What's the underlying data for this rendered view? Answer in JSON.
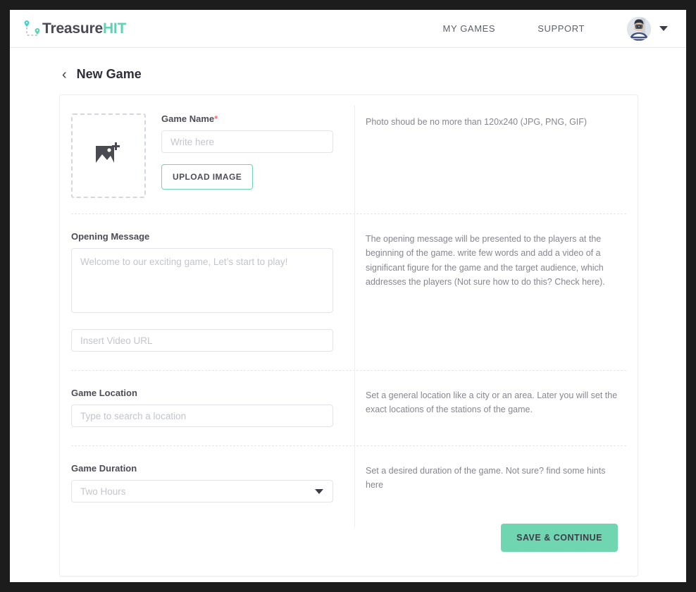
{
  "brand": {
    "name_main": "Treasure",
    "name_accent": "HIT",
    "accent_color": "#5ed3b4",
    "logo_icon": "dashed-route-map-pins-icon"
  },
  "nav": {
    "links": [
      {
        "label": "MY GAMES",
        "name": "nav-my-games"
      },
      {
        "label": "SUPPORT",
        "name": "nav-support"
      }
    ],
    "avatar_alt": "user-avatar",
    "caret_icon": "chevron-down-icon"
  },
  "page": {
    "back_icon": "‹",
    "title": "New Game"
  },
  "sections": {
    "image": {
      "dropzone_icon": "add-image-icon",
      "name_label": "Game Name",
      "required_mark": "*",
      "name_placeholder": "Write here",
      "name_value": "",
      "upload_button": "UPLOAD IMAGE",
      "helper": "Photo shoud be no more than 120x240 (JPG, PNG, GIF)"
    },
    "opening": {
      "label": "Opening Message",
      "message_placeholder": "Welcome to our exciting game, Let’s start to play!",
      "message_value": "",
      "video_placeholder": "Insert Video URL",
      "video_value": "",
      "helper": "The opening message will be presented to the players at the beginning of the game. write few words and add a video of a significant figure for the game and the target audience, which addresses the players (Not sure how to do this? Check here)."
    },
    "location": {
      "label": "Game Location",
      "placeholder": "Type to search a location",
      "value": "",
      "helper": "Set a general location like a city or an area. Later you will set the exact locations of the stations of the game."
    },
    "duration": {
      "label": "Game Duration",
      "selected": "Two Hours",
      "options": [
        "Two Hours"
      ],
      "arrow_icon": "dropdown-arrow-icon",
      "helper": "Set a desired duration of the game. Not sure? find some hints here"
    }
  },
  "footer": {
    "save_button": "SAVE & CONTINUE",
    "save_color": "#70d6b2"
  }
}
